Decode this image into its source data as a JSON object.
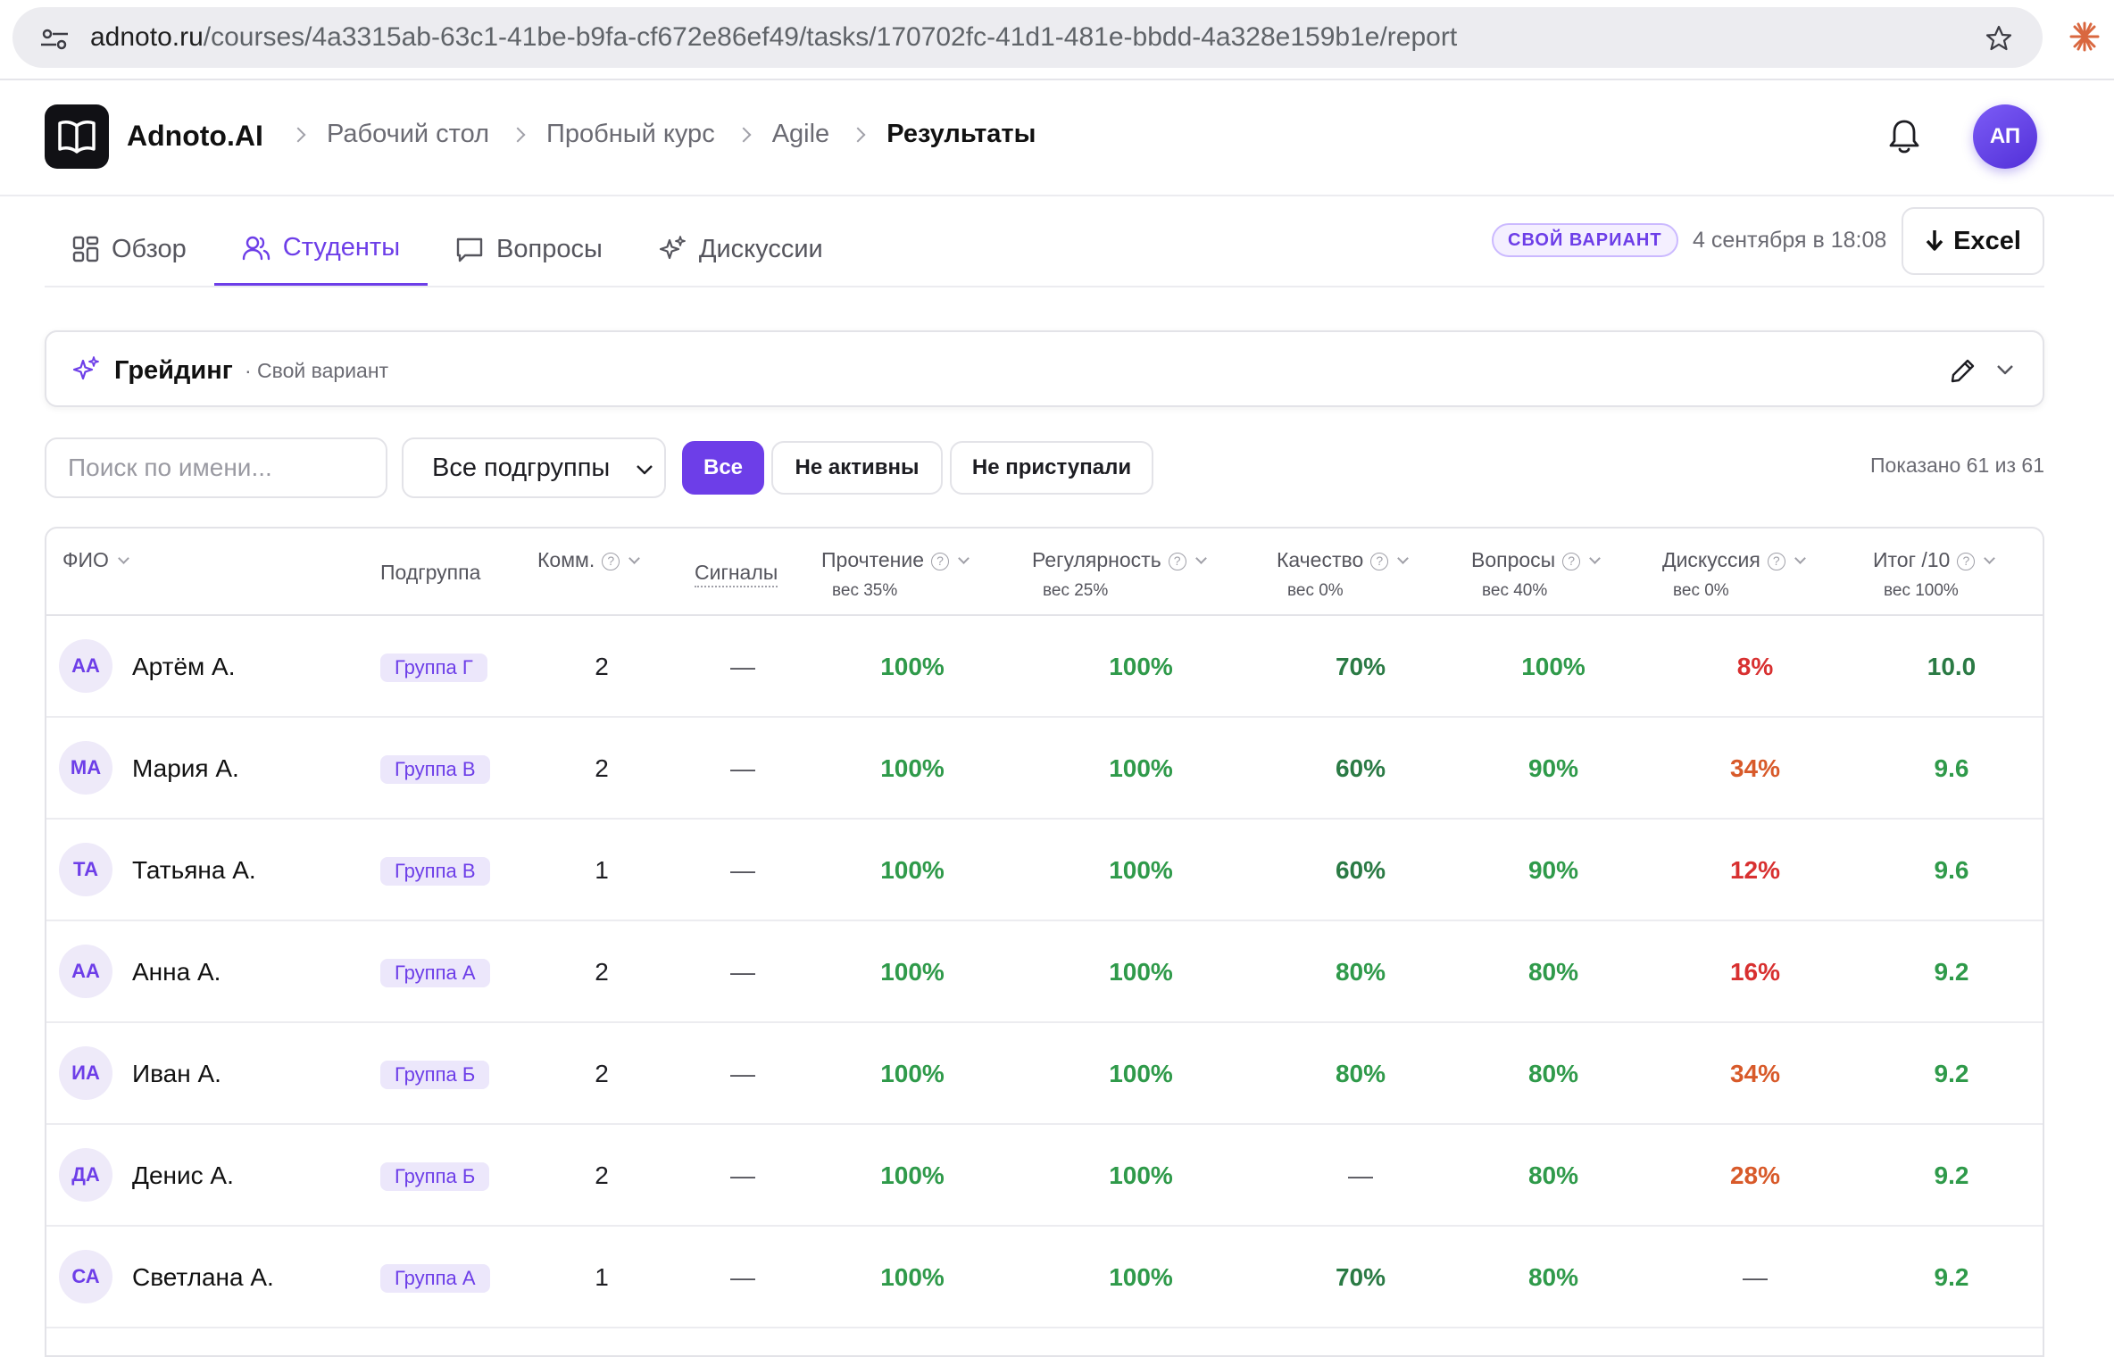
{
  "browser": {
    "url_host": "adnoto.ru",
    "url_path": "/courses/4a3315ab-63c1-41be-b9fa-cf672e86ef49/tasks/170702fc-41d1-481e-bbdd-4a328e159b1e/report"
  },
  "header": {
    "brand": "Adnoto.AI",
    "breadcrumbs": [
      "Рабочий стол",
      "Пробный курс",
      "Agile"
    ],
    "current": "Результаты",
    "user_initials": "АП"
  },
  "tabs": [
    {
      "label": "Обзор",
      "icon": "grid-icon"
    },
    {
      "label": "Студенты",
      "icon": "users-icon"
    },
    {
      "label": "Вопросы",
      "icon": "chat-icon"
    },
    {
      "label": "Дискуссии",
      "icon": "sparkle-icon"
    }
  ],
  "active_tab": "Студенты",
  "variant_badge": "СВОЙ ВАРИАНТ",
  "report_date": "4 сентября в 18:08",
  "export_label": "Excel",
  "grading": {
    "title": "Грейдинг",
    "subtitle": "· Свой вариант"
  },
  "filters": {
    "search_placeholder": "Поиск по имени...",
    "subgroup_select": "Все подгруппы",
    "buttons": [
      "Все",
      "Не активны",
      "Не приступали"
    ],
    "active_button": "Все",
    "shown": "Показано 61 из 61"
  },
  "table": {
    "columns": {
      "name": "ФИО",
      "group": "Подгруппа",
      "comments": "Комм.",
      "signals": "Сигналы",
      "reading": "Прочтение",
      "reading_weight": "вес 35%",
      "regularity": "Регулярность",
      "regularity_weight": "вес 25%",
      "quality": "Качество",
      "quality_weight": "вес 0%",
      "questions": "Вопросы",
      "questions_weight": "вес 40%",
      "discussion": "Дискуссия",
      "discussion_weight": "вес 0%",
      "total": "Итог /10",
      "total_weight": "вес 100%"
    },
    "rows": [
      {
        "initials": "АА",
        "name": "Артём А.",
        "group": "Группа Г",
        "comments": "2",
        "signals": "—",
        "reading": "100%",
        "regularity": "100%",
        "quality": "70%",
        "questions": "100%",
        "discussion": "8%",
        "total": "10.0"
      },
      {
        "initials": "МА",
        "name": "Мария А.",
        "group": "Группа В",
        "comments": "2",
        "signals": "—",
        "reading": "100%",
        "regularity": "100%",
        "quality": "60%",
        "questions": "90%",
        "discussion": "34%",
        "total": "9.6"
      },
      {
        "initials": "ТА",
        "name": "Татьяна А.",
        "group": "Группа В",
        "comments": "1",
        "signals": "—",
        "reading": "100%",
        "regularity": "100%",
        "quality": "60%",
        "questions": "90%",
        "discussion": "12%",
        "total": "9.6"
      },
      {
        "initials": "АА",
        "name": "Анна А.",
        "group": "Группа А",
        "comments": "2",
        "signals": "—",
        "reading": "100%",
        "regularity": "100%",
        "quality": "80%",
        "questions": "80%",
        "discussion": "16%",
        "total": "9.2"
      },
      {
        "initials": "ИА",
        "name": "Иван А.",
        "group": "Группа Б",
        "comments": "2",
        "signals": "—",
        "reading": "100%",
        "regularity": "100%",
        "quality": "80%",
        "questions": "80%",
        "discussion": "34%",
        "total": "9.2"
      },
      {
        "initials": "ДА",
        "name": "Денис А.",
        "group": "Группа Б",
        "comments": "2",
        "signals": "—",
        "reading": "100%",
        "regularity": "100%",
        "quality": "—",
        "questions": "80%",
        "discussion": "28%",
        "total": "9.2"
      },
      {
        "initials": "СА",
        "name": "Светлана А.",
        "group": "Группа А",
        "comments": "1",
        "signals": "—",
        "reading": "100%",
        "regularity": "100%",
        "quality": "70%",
        "questions": "80%",
        "discussion": "—",
        "total": "9.2"
      }
    ]
  },
  "colors": {
    "accent": "#6d3ee8",
    "good": "#2f9a4a",
    "good_dark": "#2a7a44",
    "bad": "#d83030",
    "warn": "#d85a2a"
  }
}
